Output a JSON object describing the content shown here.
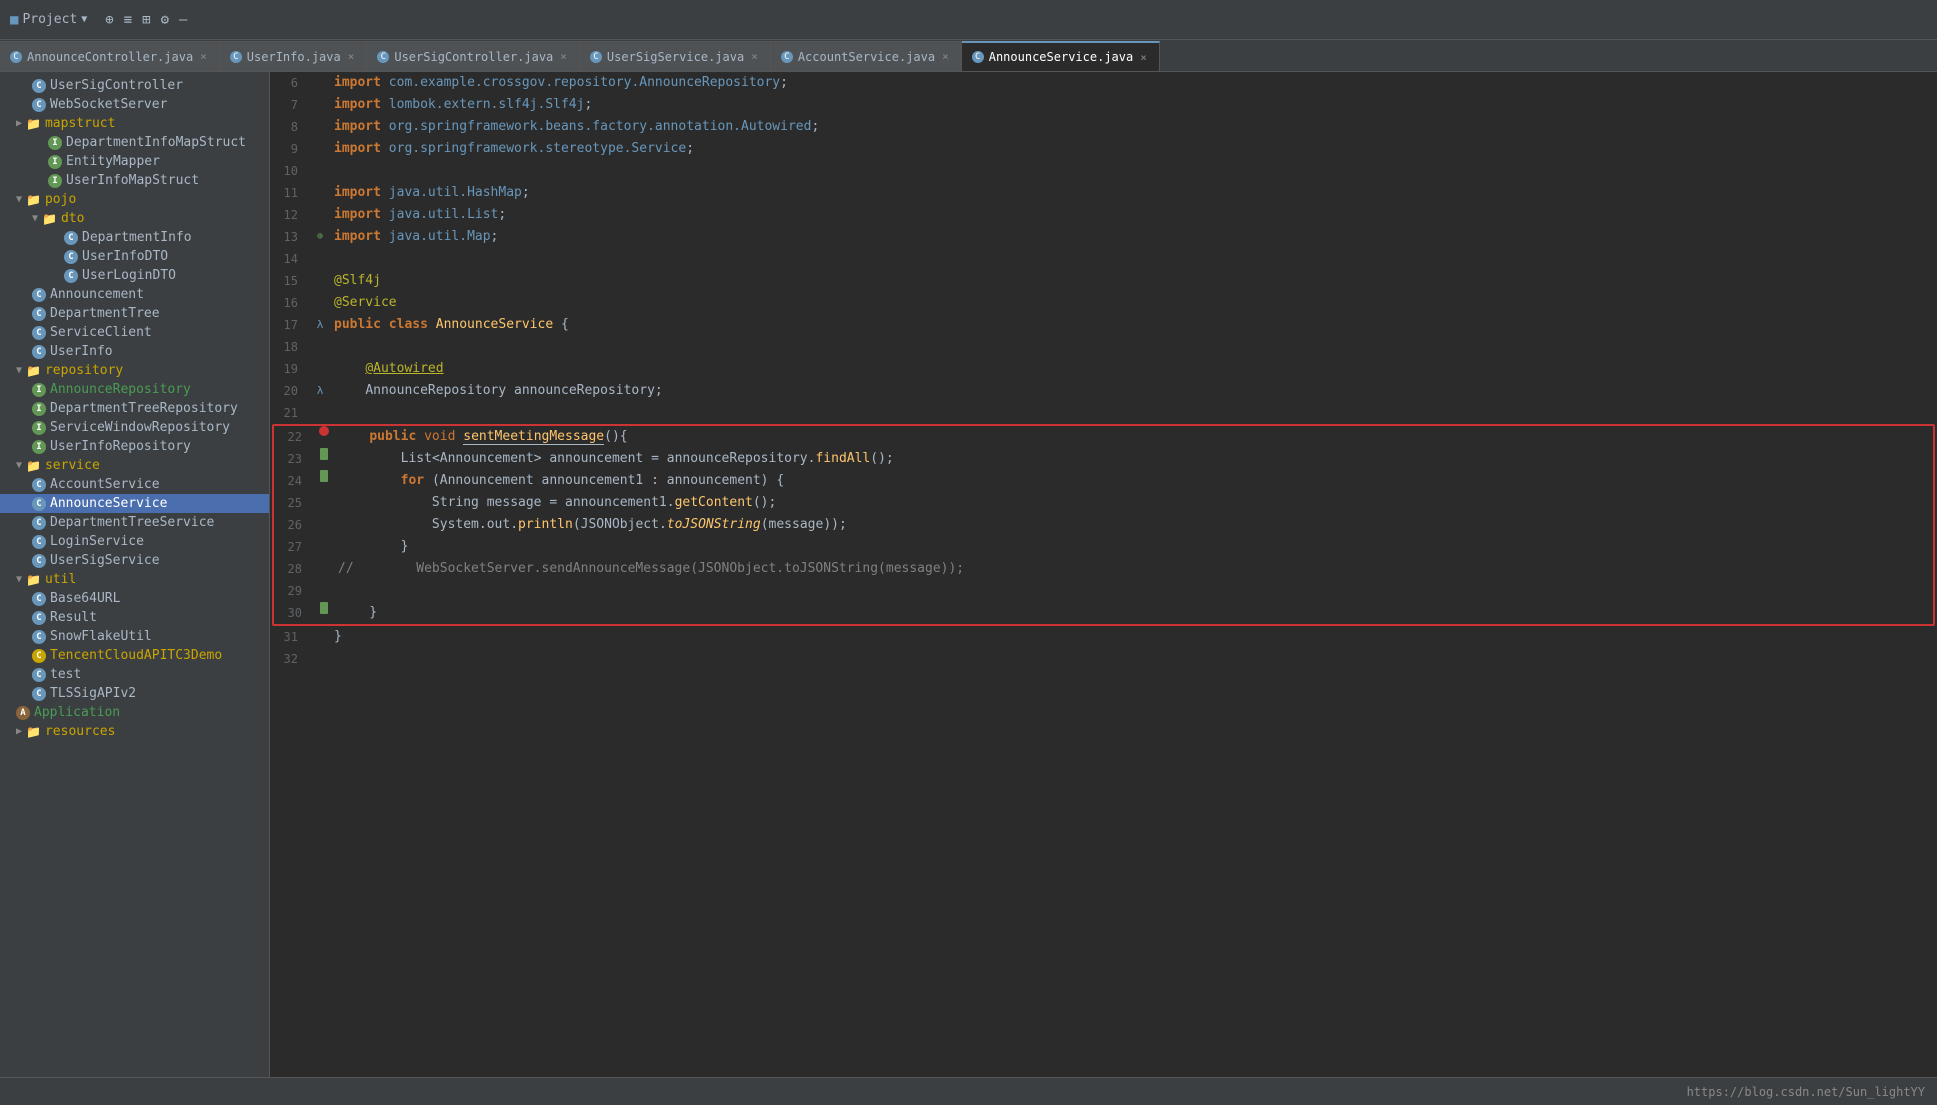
{
  "titleBar": {
    "projectLabel": "Project",
    "icons": [
      "⊕",
      "≡",
      "⊞",
      "⚙",
      "—"
    ]
  },
  "tabs": [
    {
      "label": "AnnounceController.java",
      "active": false,
      "icon": "C"
    },
    {
      "label": "UserInfo.java",
      "active": false,
      "icon": "C"
    },
    {
      "label": "UserSigController.java",
      "active": false,
      "icon": "C"
    },
    {
      "label": "UserSigService.java",
      "active": false,
      "icon": "C"
    },
    {
      "label": "AccountService.java",
      "active": false,
      "icon": "C"
    },
    {
      "label": "AnnounceService.java",
      "active": true,
      "icon": "C"
    }
  ],
  "sidebar": {
    "items": [
      {
        "label": "UserSigController",
        "indent": "indent-2",
        "icon": "C",
        "type": "file-c"
      },
      {
        "label": "WebSocketServer",
        "indent": "indent-2",
        "icon": "C",
        "type": "file-c"
      },
      {
        "label": "mapstruct",
        "indent": "indent-1",
        "icon": "▶",
        "type": "folder"
      },
      {
        "label": "DepartmentInfoMapStruct",
        "indent": "indent-3",
        "icon": "I",
        "type": "file-i"
      },
      {
        "label": "EntityMapper",
        "indent": "indent-3",
        "icon": "I",
        "type": "file-i"
      },
      {
        "label": "UserInfoMapStruct",
        "indent": "indent-3",
        "icon": "I",
        "type": "file-i"
      },
      {
        "label": "pojo",
        "indent": "indent-1",
        "icon": "▼",
        "type": "folder"
      },
      {
        "label": "dto",
        "indent": "indent-2",
        "icon": "▼",
        "type": "folder"
      },
      {
        "label": "DepartmentInfo",
        "indent": "indent-4",
        "icon": "C",
        "type": "file-c"
      },
      {
        "label": "UserInfoDTO",
        "indent": "indent-4",
        "icon": "C",
        "type": "file-c"
      },
      {
        "label": "UserLoginDTO",
        "indent": "indent-4",
        "icon": "C",
        "type": "file-c"
      },
      {
        "label": "Announcement",
        "indent": "indent-2",
        "icon": "C",
        "type": "file-c"
      },
      {
        "label": "DepartmentTree",
        "indent": "indent-2",
        "icon": "C",
        "type": "file-c"
      },
      {
        "label": "ServiceClient",
        "indent": "indent-2",
        "icon": "C",
        "type": "file-c"
      },
      {
        "label": "UserInfo",
        "indent": "indent-2",
        "icon": "C",
        "type": "file-c"
      },
      {
        "label": "repository",
        "indent": "indent-1",
        "icon": "▼",
        "type": "folder"
      },
      {
        "label": "AnnounceRepository",
        "indent": "indent-2",
        "icon": "I",
        "type": "file-i"
      },
      {
        "label": "DepartmentTreeRepository",
        "indent": "indent-2",
        "icon": "I",
        "type": "file-i"
      },
      {
        "label": "ServiceWindowRepository",
        "indent": "indent-2",
        "icon": "I",
        "type": "file-i"
      },
      {
        "label": "UserInfoRepository",
        "indent": "indent-2",
        "icon": "I",
        "type": "file-i"
      },
      {
        "label": "service",
        "indent": "indent-1",
        "icon": "▼",
        "type": "folder"
      },
      {
        "label": "AccountService",
        "indent": "indent-2",
        "icon": "C",
        "type": "file-c"
      },
      {
        "label": "AnnounceService",
        "indent": "indent-2",
        "icon": "C",
        "type": "file-c",
        "selected": true
      },
      {
        "label": "DepartmentTreeService",
        "indent": "indent-2",
        "icon": "C",
        "type": "file-c"
      },
      {
        "label": "LoginService",
        "indent": "indent-2",
        "icon": "C",
        "type": "file-c"
      },
      {
        "label": "UserSigService",
        "indent": "indent-2",
        "icon": "C",
        "type": "file-c"
      },
      {
        "label": "util",
        "indent": "indent-1",
        "icon": "▼",
        "type": "folder"
      },
      {
        "label": "Base64URL",
        "indent": "indent-2",
        "icon": "C",
        "type": "file-c"
      },
      {
        "label": "Result",
        "indent": "indent-2",
        "icon": "C",
        "type": "file-c"
      },
      {
        "label": "SnowFlakeUtil",
        "indent": "indent-2",
        "icon": "C",
        "type": "file-c"
      },
      {
        "label": "TencentCloudAPITC3Demo",
        "indent": "indent-2",
        "icon": "C",
        "type": "file-c",
        "color": "yellow"
      },
      {
        "label": "test",
        "indent": "indent-2",
        "icon": "C",
        "type": "file-c"
      },
      {
        "label": "TLSSigAPIv2",
        "indent": "indent-2",
        "icon": "C",
        "type": "file-c"
      },
      {
        "label": "Application",
        "indent": "indent-1",
        "icon": "A",
        "type": "file-a"
      },
      {
        "label": "resources",
        "indent": "indent-1",
        "icon": "▶",
        "type": "folder"
      }
    ]
  },
  "code": {
    "lines": [
      {
        "num": 6,
        "content": "import com.example.crossgov.repository.AnnounceRepository;",
        "gutter": ""
      },
      {
        "num": 7,
        "content": "import lombok.extern.slf4j.Slf4j;",
        "gutter": ""
      },
      {
        "num": 8,
        "content": "import org.springframework.beans.factory.annotation.Autowired;",
        "gutter": ""
      },
      {
        "num": 9,
        "content": "import org.springframework.stereotype.Service;",
        "gutter": ""
      },
      {
        "num": 10,
        "content": "",
        "gutter": ""
      },
      {
        "num": 11,
        "content": "import java.util.HashMap;",
        "gutter": ""
      },
      {
        "num": 12,
        "content": "import java.util.List;",
        "gutter": ""
      },
      {
        "num": 13,
        "content": "import java.util.Map;",
        "gutter": "collapse"
      },
      {
        "num": 14,
        "content": "",
        "gutter": ""
      },
      {
        "num": 15,
        "content": "@Slf4j",
        "gutter": ""
      },
      {
        "num": 16,
        "content": "@Service",
        "gutter": ""
      },
      {
        "num": 17,
        "content": "public class AnnounceService {",
        "gutter": "lambda"
      },
      {
        "num": 18,
        "content": "",
        "gutter": ""
      },
      {
        "num": 19,
        "content": "    @Autowired",
        "gutter": ""
      },
      {
        "num": 20,
        "content": "    AnnounceRepository announceRepository;",
        "gutter": "lambda"
      },
      {
        "num": 21,
        "content": "",
        "gutter": ""
      },
      {
        "num": 22,
        "content": "    public void sentMeetingMessage(){",
        "gutter": "breakpoint"
      },
      {
        "num": 23,
        "content": "        List<Announcement> announcement = announceRepository.findAll();",
        "gutter": "bookmark"
      },
      {
        "num": 24,
        "content": "        for (Announcement announcement1 : announcement) {",
        "gutter": "bookmark"
      },
      {
        "num": 25,
        "content": "            String message = announcement1.getContent();",
        "gutter": ""
      },
      {
        "num": 26,
        "content": "            System.out.println(JSONObject.toJSONString(message));",
        "gutter": ""
      },
      {
        "num": 27,
        "content": "        }",
        "gutter": ""
      },
      {
        "num": 28,
        "content": "//        WebSocketServer.sendAnnounceMessage(JSONObject.toJSONString(message));",
        "gutter": ""
      },
      {
        "num": 29,
        "content": "",
        "gutter": ""
      },
      {
        "num": 30,
        "content": "    }",
        "gutter": "bookmark"
      },
      {
        "num": 31,
        "content": "}",
        "gutter": ""
      },
      {
        "num": 32,
        "content": "",
        "gutter": ""
      }
    ]
  },
  "statusBar": {
    "url": "https://blog.csdn.net/Sun_lightYY"
  }
}
